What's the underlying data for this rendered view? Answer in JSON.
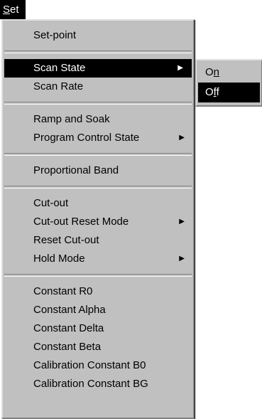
{
  "menubar": {
    "set": {
      "mnemonic": "S",
      "rest": "et"
    }
  },
  "menu": {
    "items": [
      {
        "label": "Set-point"
      },
      {
        "label": "Scan State",
        "arrow": "▶"
      },
      {
        "label": "Scan Rate"
      },
      {
        "label": "Ramp and Soak"
      },
      {
        "label": "Program Control State",
        "arrow": "▶"
      },
      {
        "label": "Proportional Band"
      },
      {
        "label": "Cut-out"
      },
      {
        "label": "Cut-out Reset Mode",
        "arrow": "▶"
      },
      {
        "label": "Reset Cut-out"
      },
      {
        "label": "Hold Mode",
        "arrow": "▶"
      },
      {
        "label": "Constant R0"
      },
      {
        "label": "Constant Alpha"
      },
      {
        "label": "Constant Delta"
      },
      {
        "label": "Constant Beta"
      },
      {
        "label": "Calibration Constant B0"
      },
      {
        "label": "Calibration Constant BG"
      }
    ]
  },
  "submenu": {
    "on": {
      "prefix": "O",
      "mnemonic": "n"
    },
    "off": {
      "prefix": "O",
      "mnemonic": "f",
      "suffix": "f"
    }
  },
  "colors": {
    "menu_bg": "#c0c0c0",
    "highlight": "#000000",
    "highlight_text": "#ffffff"
  }
}
